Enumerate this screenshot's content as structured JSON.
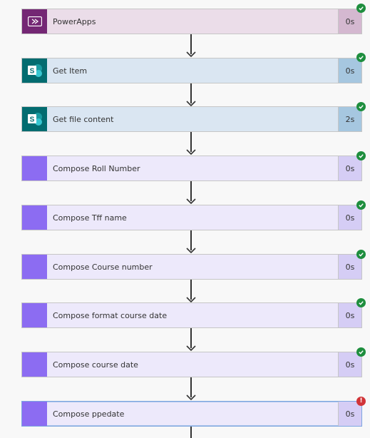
{
  "colors": {
    "powerapps_icon": "#742774",
    "powerapps_bg": "#ebdde9",
    "powerapps_duration_bg": "#d4b8d0",
    "sharepoint_icon": "#036c70",
    "sharepoint_bg": "#dae6f2",
    "sharepoint_duration_bg": "#a6c7e0",
    "compose_icon": "#8c6cf2",
    "compose_bg": "#ede9fb",
    "compose_duration_bg": "#d5cdf5",
    "success": "#1e8e3e",
    "error": "#d13438"
  },
  "steps": [
    {
      "label": "PowerApps",
      "duration": "0s",
      "icon": "powerapps-icon",
      "status": "success"
    },
    {
      "label": "Get Item",
      "duration": "0s",
      "icon": "sharepoint-icon",
      "status": "success"
    },
    {
      "label": "Get file content",
      "duration": "2s",
      "icon": "sharepoint-icon",
      "status": "success"
    },
    {
      "label": "Compose Roll Number",
      "duration": "0s",
      "icon": "compose-icon",
      "status": "success"
    },
    {
      "label": "Compose Tff name",
      "duration": "0s",
      "icon": "compose-icon",
      "status": "success"
    },
    {
      "label": "Compose Course number",
      "duration": "0s",
      "icon": "compose-icon",
      "status": "success"
    },
    {
      "label": "Compose format course date",
      "duration": "0s",
      "icon": "compose-icon",
      "status": "success"
    },
    {
      "label": "Compose course date",
      "duration": "0s",
      "icon": "compose-icon",
      "status": "success"
    },
    {
      "label": "Compose ppedate",
      "duration": "0s",
      "icon": "compose-icon",
      "status": "error"
    }
  ]
}
